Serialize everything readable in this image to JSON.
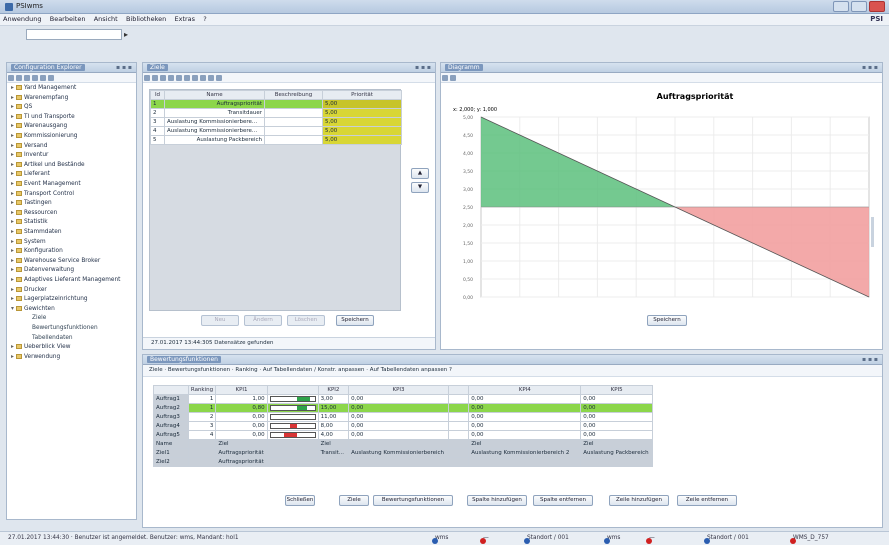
{
  "window": {
    "title": "PSIwms"
  },
  "menu": {
    "items": [
      "Anwendung",
      "Bearbeiten",
      "Ansicht",
      "Bibliotheken",
      "Extras",
      "?"
    ],
    "brand": "PSI"
  },
  "tree": {
    "title": "Configuration Explorer",
    "buttons": "▪ ▪ ▪",
    "items": [
      {
        "label": "Yard Management",
        "indent": 0
      },
      {
        "label": "Warenempfang",
        "indent": 0
      },
      {
        "label": "QS",
        "indent": 0
      },
      {
        "label": "TI und Transporte",
        "indent": 0
      },
      {
        "label": "Warenausgang",
        "indent": 0
      },
      {
        "label": "Kommissionierung",
        "indent": 0
      },
      {
        "label": "Versand",
        "indent": 0
      },
      {
        "label": "Inventur",
        "indent": 0
      },
      {
        "label": "Artikel und Bestände",
        "indent": 0
      },
      {
        "label": "Lieferant",
        "indent": 0
      },
      {
        "label": "Event Management",
        "indent": 0
      },
      {
        "label": "Transport Control",
        "indent": 0
      },
      {
        "label": "Tastingen",
        "indent": 0
      },
      {
        "label": "Ressourcen",
        "indent": 0
      },
      {
        "label": "Statistik",
        "indent": 0
      },
      {
        "label": "Stammdaten",
        "indent": 0
      },
      {
        "label": "System",
        "indent": 0
      },
      {
        "label": "Konfiguration",
        "indent": 0
      },
      {
        "label": "Warehouse Service Broker",
        "indent": 0
      },
      {
        "label": "Datenverwaltung",
        "indent": 0
      },
      {
        "label": "Adaptives Lieferant Management",
        "indent": 0
      },
      {
        "label": "Drucker",
        "indent": 0
      },
      {
        "label": "Lagerplatzeinrichtung",
        "indent": 0
      },
      {
        "label": "Gewichten",
        "indent": 0,
        "open": true
      },
      {
        "label": "Ziele",
        "indent": 2
      },
      {
        "label": "Bewertungsfunktionen",
        "indent": 2
      },
      {
        "label": "Tabellendaten",
        "indent": 2
      },
      {
        "label": "Ueberblick View",
        "indent": 0
      },
      {
        "label": "Verwendung",
        "indent": 0
      }
    ]
  },
  "targets": {
    "title": "Ziele",
    "status_time": "27.01.2017 13:44:30",
    "status_msg": "5 Datensätze gefunden",
    "columns": [
      "Id",
      "Name",
      "Beschreibung",
      "Priorität"
    ],
    "rows": [
      {
        "id": "1",
        "name": "Auftragspriorität",
        "desc": "",
        "prio": "5,00"
      },
      {
        "id": "2",
        "name": "Transitdauer",
        "desc": "",
        "prio": "5,00"
      },
      {
        "id": "3",
        "name": "Auslastung Kommissionierbere...",
        "desc": "",
        "prio": "5,00"
      },
      {
        "id": "4",
        "name": "Auslastung Kommissionierbere...",
        "desc": "",
        "prio": "5,00"
      },
      {
        "id": "5",
        "name": "Auslastung Packbereich",
        "desc": "",
        "prio": "5,00"
      }
    ],
    "side_buttons": [
      "▲",
      "▼"
    ],
    "buttons": [
      "Neu",
      "Ändern",
      "Löschen",
      "Speichern"
    ]
  },
  "chart_panel": {
    "title": "Diagramm",
    "save_button": "Speichern"
  },
  "chart_data": {
    "type": "area",
    "title": "Auftragspriorität",
    "subtitle": "x: 2,000; y: 1,000",
    "x": [
      0,
      1,
      2,
      3,
      4,
      5,
      6,
      7,
      8,
      9,
      10
    ],
    "y": [
      5,
      4.5,
      4,
      3.5,
      3,
      2.5,
      2,
      1.5,
      1,
      0.5,
      0
    ],
    "baseline": 2.5,
    "ylim": [
      0,
      5
    ],
    "yticks": [
      "5,00",
      "4,50",
      "4,00",
      "3,50",
      "3,00",
      "2,50",
      "2,00",
      "1,50",
      "1,00",
      "0,50",
      "0,00"
    ],
    "colors": {
      "above": "#5cbf7c",
      "below": "#f2a0a0"
    },
    "grid": true
  },
  "eval": {
    "title": "Bewertungsfunktionen",
    "tabs": [
      "Ziele",
      "Bewertungsfunktionen",
      "Ranking",
      "Auf Tabellendaten / Konstr. anpassen",
      "Auf Tabellendaten anpassen",
      "?"
    ],
    "columns": [
      "",
      "Ranking",
      "KPI1",
      "",
      "KPI2",
      "KPI3",
      "",
      "KPI4",
      "KPI5"
    ],
    "rows": [
      {
        "name": "Auftrag1",
        "rank": "1",
        "kpi1": "1,00",
        "bar": 0.6,
        "barcolor": "#2fa34a",
        "kpi2": "3,00",
        "kpi3": "0,00",
        "kpi4": "0,00",
        "kpi5": "0,00"
      },
      {
        "name": "Auftrag2",
        "rank": "1",
        "kpi1": "0,80",
        "bar": 0.45,
        "barcolor": "#2fa34a",
        "kpi2": "15,00",
        "kpi3": "0,00",
        "kpi4": "0,00",
        "kpi5": "0,00"
      },
      {
        "name": "Auftrag3",
        "rank": "2",
        "kpi1": "0,00",
        "bar": 0,
        "barcolor": "#d93535",
        "kpi2": "11,00",
        "kpi3": "0,00",
        "kpi4": "0,00",
        "kpi5": "0,00"
      },
      {
        "name": "Auftrag4",
        "rank": "3",
        "kpi1": "0,00",
        "bar": 0.25,
        "barcolor": "#d93535",
        "kpi2": "8,00",
        "kpi3": "0,00",
        "kpi4": "0,00",
        "kpi5": "0,00"
      },
      {
        "name": "Auftrag5",
        "rank": "4",
        "kpi1": "0,00",
        "bar": 0.5,
        "barcolor": "#d93535",
        "kpi2": "4,00",
        "kpi3": "0,00",
        "kpi4": "0,00",
        "kpi5": "0,00"
      }
    ],
    "footer": [
      [
        "Name",
        "",
        "Ziel",
        "",
        "Ziel",
        "",
        "",
        "Ziel",
        "Ziel"
      ],
      [
        "Ziel1",
        "",
        "Auftragspriorität",
        "",
        "Transit...",
        "Auslastung Kommissionierbereich",
        "",
        "Auslastung Kommissionierbereich 2",
        "Auslastung Packbereich"
      ],
      [
        "Ziel2",
        "",
        "Auftragspriorität",
        "",
        "",
        "",
        "",
        "",
        ""
      ]
    ],
    "buttons": [
      "Schließen",
      "Ziele",
      "Bewertungsfunktionen",
      "Spalte hinzufügen",
      "Spalte entfernen",
      "Zeile hinzufügen",
      "Zeile entfernen"
    ]
  },
  "statusbar": {
    "left": "27.01.2017 13:44:30 · Benutzer ist angemeldet. Benutzer: wms, Mandant: hol1",
    "items": [
      {
        "label": "wms",
        "color": "#2a5db0"
      },
      {
        "label": "—",
        "color": "#d02020"
      },
      {
        "label": "Standort / 001",
        "color": "#2a5db0"
      },
      {
        "label": "wms",
        "color": "#2a5db0"
      },
      {
        "label": "—",
        "color": "#d02020"
      },
      {
        "label": "Standort / 001",
        "color": "#2a5db0"
      },
      {
        "label": "WMS_D_757",
        "color": "#d02020"
      }
    ]
  }
}
